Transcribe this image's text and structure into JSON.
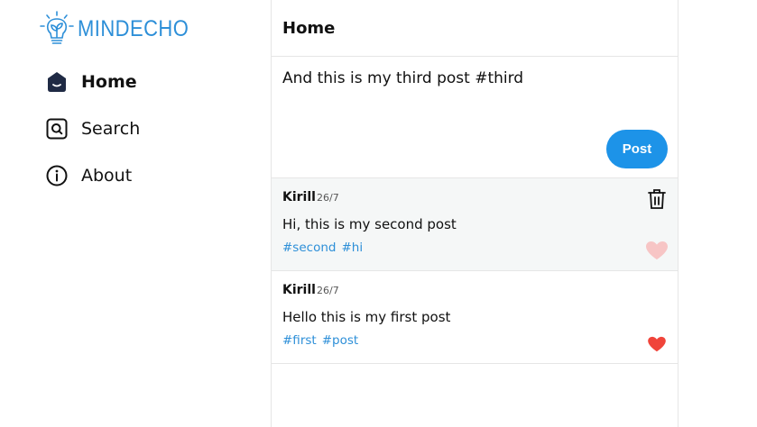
{
  "brand": {
    "name": "MINDECHO",
    "color": "#2d8fd8"
  },
  "nav": {
    "items": [
      {
        "label": "Home",
        "icon": "home-icon",
        "active": true
      },
      {
        "label": "Search",
        "icon": "search-icon",
        "active": false
      },
      {
        "label": "About",
        "icon": "info-icon",
        "active": false
      }
    ]
  },
  "main": {
    "title": "Home",
    "composer": {
      "text": "And this is my third post #third",
      "button_label": "Post",
      "button_color": "#1d93e8"
    },
    "posts": [
      {
        "author": "Kirill",
        "date": "26/7",
        "text": "Hi, this is my second post",
        "tags": [
          "#second",
          "#hi"
        ],
        "liked": false,
        "deletable": true,
        "like_color": "#f7c5c5"
      },
      {
        "author": "Kirill",
        "date": "26/7",
        "text": "Hello this is my first post",
        "tags": [
          "#first",
          "#post"
        ],
        "liked": true,
        "deletable": false,
        "like_color": "#f0443a"
      }
    ]
  }
}
